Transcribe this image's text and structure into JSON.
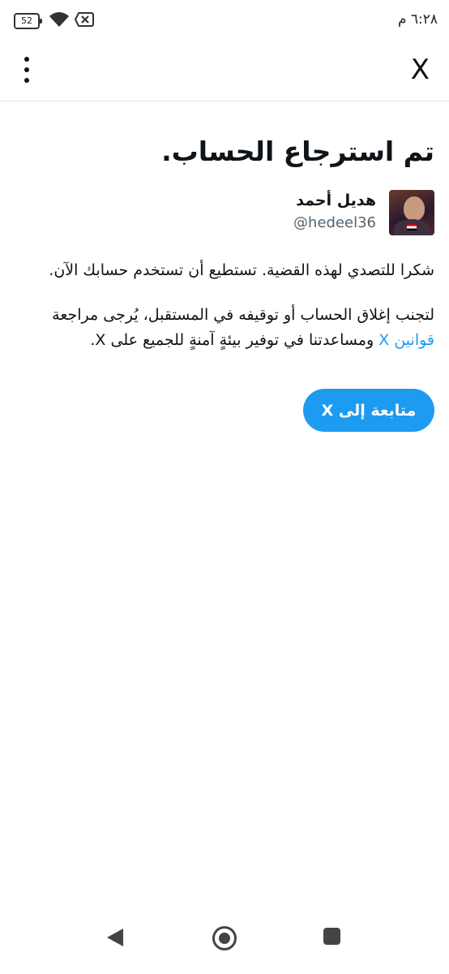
{
  "status_bar": {
    "battery_level": "52",
    "time": "٦:٢٨ م",
    "icons": [
      "battery-icon",
      "wifi-icon",
      "no-signal-icon"
    ]
  },
  "topbar": {
    "close_label": "X",
    "menu_icon": "more-vertical-icon"
  },
  "main": {
    "headline": "تم استرجاع الحساب.",
    "user": {
      "name": "هديل أحمد",
      "handle": "@hedeel36"
    },
    "paragraph_1": "شكرا للتصدي لهذه القضية. تستطيع أن تستخدم حسابك الآن.",
    "paragraph_2_before": "لتجنب إغلاق الحساب أو توقيفه في المستقبل، يُرجى مراجعة",
    "paragraph_2_link": "قوانين X",
    "paragraph_2_after": "ومساعدتنا في توفير بيئةٍ آمنةٍ للجميع على X.",
    "continue_button": "متابعة إلى X"
  },
  "colors": {
    "accent": "#1d9bf0",
    "text": "#0f1419",
    "secondary": "#536471"
  },
  "nav_bar": {
    "icons": [
      "back-icon",
      "home-icon",
      "recent-apps-icon"
    ]
  }
}
